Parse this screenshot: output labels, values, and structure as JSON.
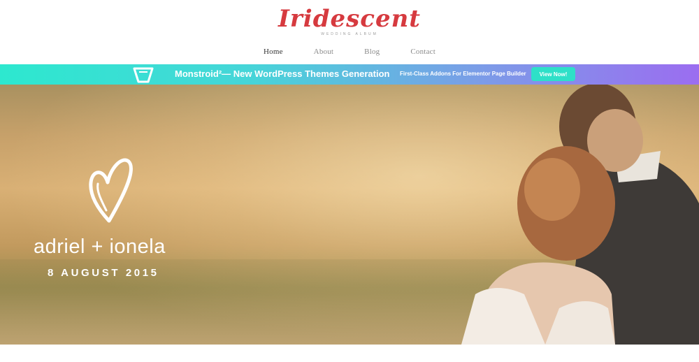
{
  "header": {
    "logo": "Iridescent",
    "tagline": "Wedding Album"
  },
  "nav": {
    "items": [
      {
        "label": "Home",
        "active": true
      },
      {
        "label": "About",
        "active": false
      },
      {
        "label": "Blog",
        "active": false
      },
      {
        "label": "Contact",
        "active": false
      }
    ]
  },
  "promo": {
    "title": "Monstroid²— New WordPress Themes Generation",
    "subtitle": "First-Class Addons For Elementor Page Builder",
    "button": "View Now!",
    "icon": "monstroid-logo-icon"
  },
  "hero": {
    "names": "adriel + ionela",
    "date": "8 AUGUST 2015",
    "icon": "heart-icon"
  },
  "colors": {
    "brand": "#d63a3f",
    "promo_start": "#2de8cf",
    "promo_end": "#9b6df0",
    "button": "#2ee0c8"
  }
}
